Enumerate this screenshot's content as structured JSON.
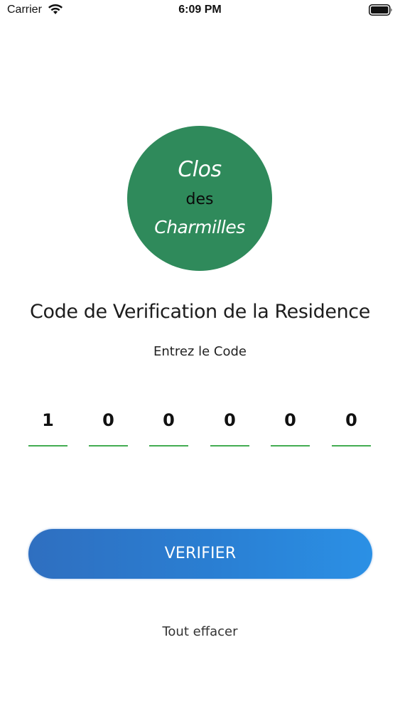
{
  "status_bar": {
    "carrier": "Carrier",
    "time": "6:09 PM",
    "icons": [
      "wifi-icon",
      "battery-icon"
    ]
  },
  "logo": {
    "line1": "Clos",
    "line2": "des",
    "line3": "Charmilles",
    "background_color": "#2f8a5b"
  },
  "title": "Code de Verification de la Residence",
  "subtitle": "Entrez le Code",
  "code": {
    "digits": [
      "1",
      "0",
      "0",
      "0",
      "0",
      "0"
    ],
    "underline_color": "#43ac52"
  },
  "verify_button": {
    "label": "VERIFIER",
    "gradient_from": "#2f6fc0",
    "gradient_to": "#2b90e5"
  },
  "clear_label": "Tout effacer"
}
